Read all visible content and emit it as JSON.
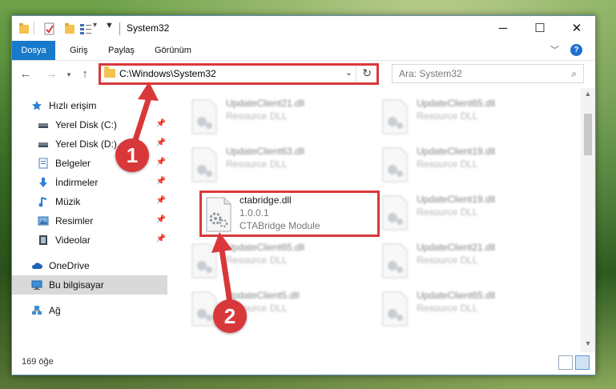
{
  "window": {
    "title": "System32",
    "controls": {
      "minimize": "─",
      "maximize": "☐",
      "close": "✕"
    }
  },
  "ribbon": {
    "tabs": [
      "Dosya",
      "Giriş",
      "Paylaş",
      "Görünüm"
    ],
    "help": "?"
  },
  "address": {
    "path": "C:\\Windows\\System32",
    "search_placeholder": "Ara: System32"
  },
  "sidebar": {
    "items": [
      {
        "label": "Hızlı erişim",
        "icon": "star-icon",
        "pinned": false
      },
      {
        "label": "Yerel Disk (C:)",
        "icon": "drive-icon",
        "pinned": true
      },
      {
        "label": "Yerel Disk (D:)",
        "icon": "drive-icon",
        "pinned": true
      },
      {
        "label": "Belgeler",
        "icon": "documents-icon",
        "pinned": true
      },
      {
        "label": "İndirmeler",
        "icon": "download-icon",
        "pinned": true
      },
      {
        "label": "Müzik",
        "icon": "music-icon",
        "pinned": true
      },
      {
        "label": "Resimler",
        "icon": "pictures-icon",
        "pinned": true
      },
      {
        "label": "Videolar",
        "icon": "videos-icon",
        "pinned": true
      },
      {
        "label": "OneDrive",
        "icon": "cloud-icon",
        "pinned": false
      },
      {
        "label": "Bu bilgisayar",
        "icon": "computer-icon",
        "pinned": false,
        "selected": true
      },
      {
        "label": "Ağ",
        "icon": "network-icon",
        "pinned": false
      }
    ]
  },
  "files": {
    "tiles": [
      {
        "name": "UpdateClient21.dll",
        "type": "Resource DLL"
      },
      {
        "name": "UpdateClient65.dll",
        "type": "Resource DLL"
      },
      {
        "name": "UpdateClient63.dll",
        "type": "Resource DLL"
      },
      {
        "name": "UpdateClient19.dll",
        "type": "Resource DLL"
      },
      {
        "name": "ctabridge.dll",
        "version": "1.0.0.1",
        "type": "CTABridge Module"
      },
      {
        "name": "UpdateClient19.dll",
        "type": "Resource DLL"
      },
      {
        "name": "UpdateClient65.dll",
        "type": "Resource DLL"
      },
      {
        "name": "UpdateClient21.dll",
        "type": "Resource DLL"
      },
      {
        "name": "UpdateClient5.dll",
        "type": "Resource DLL"
      },
      {
        "name": "UpdateClient65.dll",
        "type": "Resource DLL"
      }
    ]
  },
  "status": {
    "count": "169 öğe"
  },
  "callouts": {
    "one": "1",
    "two": "2"
  },
  "colors": {
    "accent": "#1979ca",
    "highlight": "#d9383a"
  }
}
